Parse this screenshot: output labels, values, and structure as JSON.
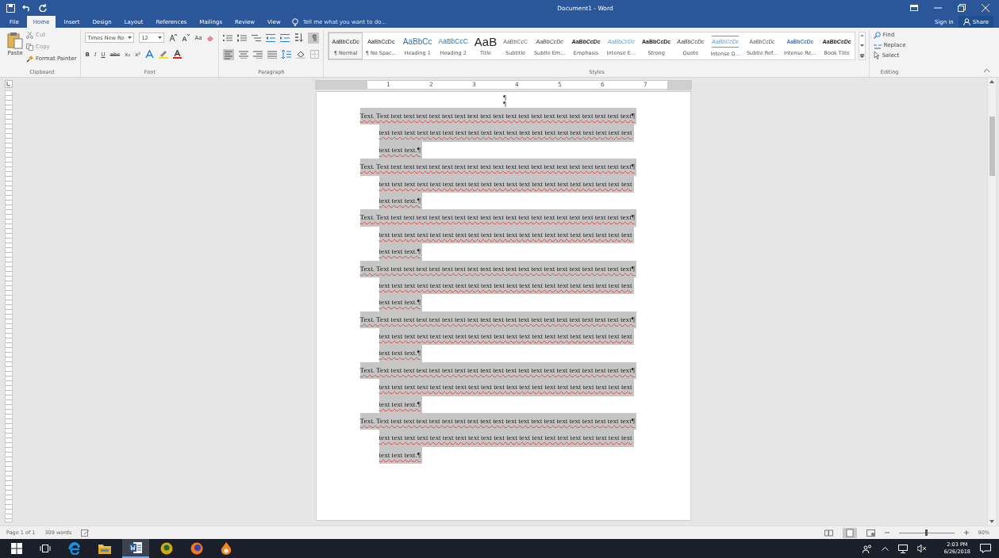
{
  "window": {
    "title": "Document1 - Word"
  },
  "tabs": [
    {
      "label": "File",
      "selected": false
    },
    {
      "label": "Home",
      "selected": true
    },
    {
      "label": "Insert",
      "selected": false
    },
    {
      "label": "Design",
      "selected": false
    },
    {
      "label": "Layout",
      "selected": false
    },
    {
      "label": "References",
      "selected": false
    },
    {
      "label": "Mailings",
      "selected": false
    },
    {
      "label": "Review",
      "selected": false
    },
    {
      "label": "View",
      "selected": false
    }
  ],
  "tell_me": {
    "placeholder": "Tell me what you want to do..."
  },
  "account": {
    "sign_in": "Sign in",
    "share": "Share"
  },
  "clipboard": {
    "paste": "Paste",
    "cut": "Cut",
    "copy": "Copy",
    "format_painter": "Format Painter",
    "label": "Clipboard"
  },
  "font": {
    "name": "Times New Ro",
    "size": "12",
    "change_case": "Aa",
    "format_buttons": [
      "B",
      "I",
      "U",
      "abc",
      "x₂",
      "x²"
    ],
    "label": "Font"
  },
  "paragraph": {
    "show_marks_on": true,
    "align_left_on": true,
    "label": "Paragraph"
  },
  "styles": {
    "label": "Styles",
    "items": [
      {
        "preview": "AaBbCcDc",
        "name": "¶ Normal",
        "kind": "normal",
        "selected": true
      },
      {
        "preview": "AaBbCcDc",
        "name": "¶ No Spac...",
        "kind": "normal",
        "selected": false
      },
      {
        "preview": "AaBbCc",
        "name": "Heading 1",
        "kind": "heading1",
        "selected": false
      },
      {
        "preview": "AaBbCcC",
        "name": "Heading 2",
        "kind": "heading2",
        "selected": false
      },
      {
        "preview": "AaB",
        "name": "Title",
        "kind": "title",
        "selected": false
      },
      {
        "preview": "AaBbCcC",
        "name": "Subtitle",
        "kind": "subtitle",
        "selected": false
      },
      {
        "preview": "AaBbCcDc",
        "name": "Subtle Em...",
        "kind": "italic",
        "selected": false
      },
      {
        "preview": "AaBbCcDc",
        "name": "Emphasis",
        "kind": "bolditalic",
        "selected": false
      },
      {
        "preview": "AaBbCcDc",
        "name": "Intense E...",
        "kind": "intense",
        "selected": false
      },
      {
        "preview": "AaBbCcDc",
        "name": "Strong",
        "kind": "strong",
        "selected": false
      },
      {
        "preview": "AaBbCcDc",
        "name": "Quote",
        "kind": "italic",
        "selected": false
      },
      {
        "preview": "AaBbCcDc",
        "name": "Intense Q...",
        "kind": "intensequote",
        "selected": false
      },
      {
        "preview": "AaBbCcDc",
        "name": "Subtle Ref...",
        "kind": "smallcaps",
        "selected": false
      },
      {
        "preview": "AaBbCcDc",
        "name": "Intense Re...",
        "kind": "intenseref",
        "selected": false
      },
      {
        "preview": "AaBbCcDc",
        "name": "Book Title",
        "kind": "bolditalic",
        "selected": false
      }
    ]
  },
  "editing": {
    "find": "Find",
    "replace": "Replace",
    "select": "Select",
    "label": "Editing"
  },
  "ruler": {
    "numbers": [
      "1",
      "2",
      "3",
      "4",
      "5",
      "6",
      "7"
    ]
  },
  "document": {
    "empty_paragraphs": [
      "¶",
      "¶"
    ],
    "paragraphs": [
      {
        "selected": true,
        "lines": [
          "Text. Text text text text text text text text text text text text text text text text text text text text¶",
          "text text text text text text text text text text text text text text text text text text text text",
          "text text text.¶"
        ]
      },
      {
        "selected": true,
        "lines": [
          "Text. Text text text text text text text text text text text text text text text text text text text text¶",
          "text text text text text text text text text text text text text text text text text text text text",
          "text text text.¶"
        ]
      },
      {
        "selected": true,
        "lines": [
          "Text. Text text text text text text text text text text text text text text text text text text text text¶",
          "text text text text text text text text text text text text text text text text text text text text",
          "text text text.¶"
        ]
      },
      {
        "selected": true,
        "lines": [
          "Text. Text text text text text text text text text text text text text text text text text text text text¶",
          "text text text text text text text text text text text text text text text text text text text text",
          "text text text.¶"
        ]
      },
      {
        "selected": true,
        "lines": [
          "Text. Text text text text text text text text text text text text text text text text text text text text¶",
          "text text text text text text text text text text text text text text text text text text text text",
          "text text text.¶"
        ]
      },
      {
        "selected": true,
        "lines": [
          "Text. Text text text text text text text text text text text text text text text text text text text text¶",
          "text text text text text text text text text text text text text text text text text text text text",
          "text text text.¶"
        ]
      },
      {
        "selected": true,
        "lines": [
          "Text. Text text text text text text text text text text text text text text text text text text text text¶",
          "text text text text text text text text text text text text text text text text text text text text",
          "text text text.¶"
        ]
      }
    ]
  },
  "status_bar": {
    "page": "Page 1 of 1",
    "words": "309 words",
    "zoom": "90%",
    "zoom_level": {
      "level": 0.5
    }
  },
  "taskbar": {
    "time": "2:03 PM",
    "date": "6/26/2018"
  }
}
